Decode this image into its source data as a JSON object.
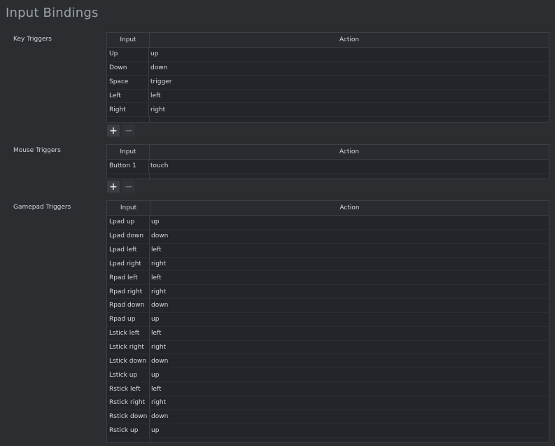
{
  "page": {
    "title": "Input Bindings"
  },
  "columns": {
    "input": "Input",
    "action": "Action"
  },
  "buttons": {
    "add": "+",
    "remove": "−"
  },
  "key_triggers": {
    "label": "Key Triggers",
    "rows": [
      {
        "input": "Up",
        "action": "up"
      },
      {
        "input": "Down",
        "action": "down"
      },
      {
        "input": "Space",
        "action": "trigger"
      },
      {
        "input": "Left",
        "action": "left"
      },
      {
        "input": "Right",
        "action": "right"
      }
    ]
  },
  "mouse_triggers": {
    "label": "Mouse Triggers",
    "rows": [
      {
        "input": "Button 1",
        "action": "touch"
      }
    ]
  },
  "gamepad_triggers": {
    "label": "Gamepad Triggers",
    "rows": [
      {
        "input": "Lpad up",
        "action": "up"
      },
      {
        "input": "Lpad down",
        "action": "down"
      },
      {
        "input": "Lpad left",
        "action": "left"
      },
      {
        "input": "Lpad right",
        "action": "right"
      },
      {
        "input": "Rpad left",
        "action": "left"
      },
      {
        "input": "Rpad right",
        "action": "right"
      },
      {
        "input": "Rpad down",
        "action": "down"
      },
      {
        "input": "Rpad up",
        "action": "up"
      },
      {
        "input": "Lstick left",
        "action": "left"
      },
      {
        "input": "Lstick right",
        "action": "right"
      },
      {
        "input": "Lstick down",
        "action": "down"
      },
      {
        "input": "Lstick up",
        "action": "up"
      },
      {
        "input": "Rstick left",
        "action": "left"
      },
      {
        "input": "Rstick right",
        "action": "right"
      },
      {
        "input": "Rstick down",
        "action": "down"
      },
      {
        "input": "Rstick up",
        "action": "up"
      }
    ]
  }
}
